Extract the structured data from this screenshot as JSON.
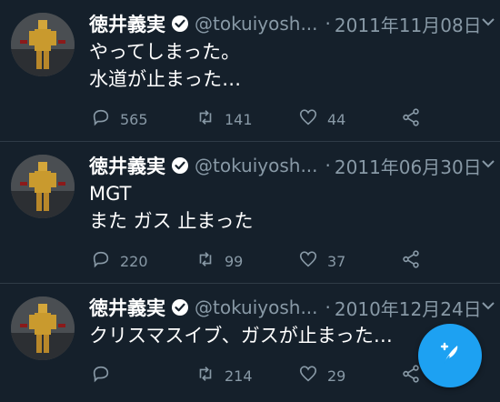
{
  "colors": {
    "background": "#15202b",
    "muted": "#8899a6",
    "accent": "#1da1f2",
    "divider": "#2f3b47"
  },
  "tweets": [
    {
      "name": "徳井義実",
      "handle": "@tokuiyosh...",
      "separator": "·",
      "date": "2011年11月08日",
      "text": "やってしまった。\n水道が止まった…",
      "reply_count": "565",
      "retweet_count": "141",
      "like_count": "44"
    },
    {
      "name": "徳井義実",
      "handle": "@tokuiyosh...",
      "separator": "·",
      "date": "2011年06月30日",
      "text": "MGT\nまた ガス 止まった",
      "reply_count": "220",
      "retweet_count": "99",
      "like_count": "37"
    },
    {
      "name": "徳井義実",
      "handle": "@tokuiyosh...",
      "separator": "·",
      "date": "2010年12月24日",
      "text": "クリスマスイブ、ガスが止まった…",
      "reply_count": "",
      "retweet_count": "214",
      "like_count": "29"
    }
  ],
  "icons": {
    "reply": "reply-icon",
    "retweet": "retweet-icon",
    "like": "heart-icon",
    "share": "share-icon",
    "verified": "verified-badge-icon",
    "caret": "chevron-down-icon",
    "compose": "compose-tweet-icon"
  }
}
